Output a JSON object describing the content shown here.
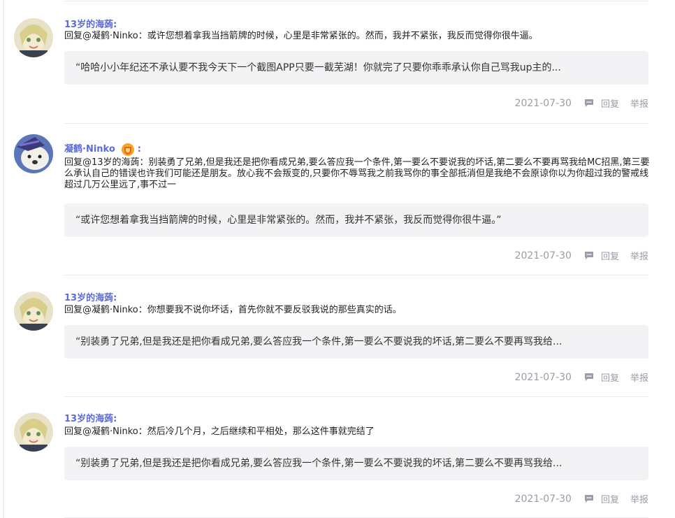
{
  "comments": [
    {
      "author": "13岁的海蒟:",
      "text": "回复@凝鹤·Ninko：或许您想着拿我当挡箭牌的时候，心里是非常紧张的。然而，我并不紧张，我反而觉得你很牛逼。",
      "quote": "“哈哈小小年纪还不承认要不我今天下一个截图APP只要一截芜湖！你就完了只要你乖乖承认你自己骂我up主的...",
      "date": "2021-07-30",
      "reply_label": "回复",
      "report_label": "举报"
    },
    {
      "author": "凝鹤·Ninko",
      "author_suffix": ":",
      "text": "回复@13岁的海蒟：别装勇了兄弟,但是我还是把你看成兄弟,要么答应我一个条件,第一要么不要说我的坏话,第二要么不要再骂我给MC招黑,第三要么承认自己的错误也许我们可能还是朋友。放心我不会叛变的,只要你不辱骂我之前我骂你的事全部抵消但是我绝不会原谅你以为你超过我的警戒线超过几万公里远了,事不过一",
      "quote": "“或许您想着拿我当挡箭牌的时候，心里是非常紧张的。然而，我并不紧张，我反而觉得你很牛逼。”",
      "date": "2021-07-30",
      "reply_label": "回复",
      "report_label": "举报"
    },
    {
      "author": "13岁的海蒟:",
      "text": "回复@凝鹤·Ninko：你想要我不说你坏话，首先你就不要反驳我说的那些真实的话。",
      "quote": "“别装勇了兄弟,但是我还是把你看成兄弟,要么答应我一个条件,第一要么不要说我的坏话,第二要么不要再骂我给...",
      "date": "2021-07-30",
      "reply_label": "回复",
      "report_label": "举报"
    },
    {
      "author": "13岁的海蒟:",
      "text": "回复@凝鹤·Ninko：然后冷几个月，之后继续和平相处，那么这件事就完结了",
      "quote": "“别装勇了兄弟,但是我还是把你看成兄弟,要么答应我一个条件,第一要么不要说我的坏话,第二要么不要再骂我给...",
      "date": "2021-07-30",
      "reply_label": "回复",
      "report_label": "举报"
    }
  ],
  "icons": {
    "reply": "chat-bubble-icon",
    "badge": "level-badge-icon"
  },
  "colors": {
    "author": "#5c6bd6",
    "meta": "#9a9ca8",
    "quote_bg": "#f3f3f5",
    "badge": "#f5a623"
  }
}
